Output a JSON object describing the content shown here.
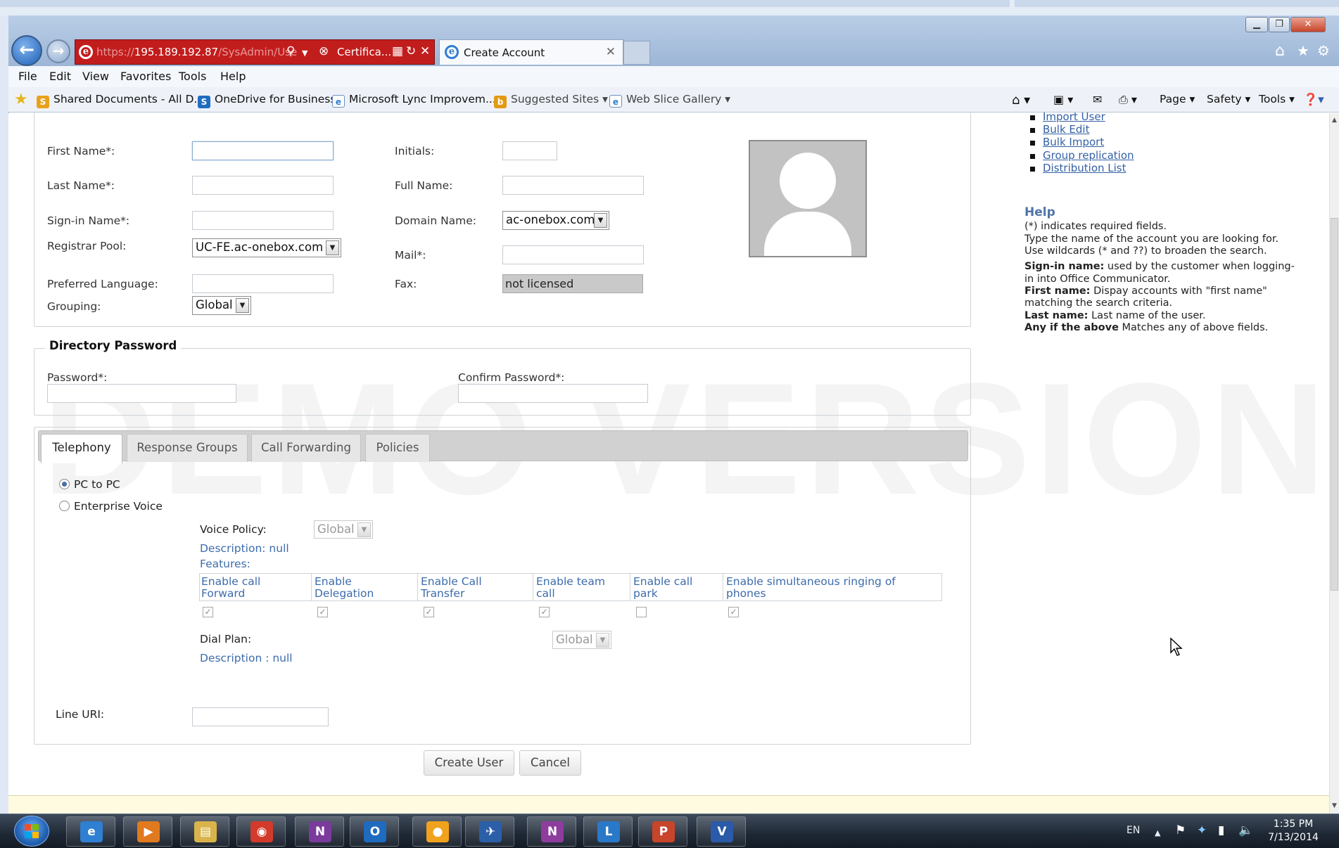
{
  "browser": {
    "url_scheme": "https://",
    "url_host": "195.189.192.87",
    "url_path": "/SysAdmin/Use",
    "certificate_label": "Certifica...",
    "tab_title": "Create Account",
    "window_controls": [
      "minimize-icon",
      "restore-icon",
      "close-icon"
    ],
    "menu": [
      "File",
      "Edit",
      "View",
      "Favorites",
      "Tools",
      "Help"
    ],
    "favorites": [
      {
        "label": "Shared Documents - All D...",
        "icon": "sharepoint-icon"
      },
      {
        "label": "OneDrive for Business",
        "icon": "onedrive-icon"
      },
      {
        "label": "Microsoft Lync Improvem...",
        "icon": "ie-page-icon"
      },
      {
        "label": "Suggested Sites ▾",
        "icon": "bing-icon"
      },
      {
        "label": "Web Slice Gallery ▾",
        "icon": "ie-page-icon"
      }
    ],
    "commands": [
      "Page ▾",
      "Safety ▾",
      "Tools ▾"
    ]
  },
  "account": {
    "labels": {
      "first_name": "First Name*:",
      "last_name": "Last Name*:",
      "signin_name": "Sign-in Name*:",
      "registrar_pool": "Registrar Pool:",
      "preferred_language": "Preferred Language:",
      "grouping": "Grouping:",
      "initials": "Initials:",
      "full_name": "Full Name:",
      "domain_name": "Domain Name:",
      "mail": "Mail*:",
      "fax": "Fax:"
    },
    "registrar_pool_value": "UC-FE.ac-onebox.com",
    "grouping_value": "Global",
    "domain_name_value": "ac-onebox.com",
    "fax_value": "not licensed"
  },
  "directory_password": {
    "title": "Directory Password",
    "password_label": "Password*:",
    "confirm_label": "Confirm Password*:"
  },
  "tabs": [
    "Telephony",
    "Response Groups",
    "Call Forwarding",
    "Policies"
  ],
  "telephony": {
    "options": [
      "PC to PC",
      "Enterprise Voice"
    ],
    "selected": "PC to PC",
    "voice_policy_label": "Voice Policy:",
    "voice_policy_value": "Global",
    "voice_description": "Description: null",
    "features_label": "Features:",
    "features": [
      {
        "line1": "Enable call",
        "line2": "Forward",
        "checked": true
      },
      {
        "line1": "Enable",
        "line2": "Delegation",
        "checked": true
      },
      {
        "line1": "Enable Call",
        "line2": "Transfer",
        "checked": true
      },
      {
        "line1": "Enable team",
        "line2": "call",
        "checked": true
      },
      {
        "line1": "Enable call",
        "line2": "park",
        "checked": false
      },
      {
        "line1": "Enable simultaneous ringing of",
        "line2": "phones",
        "checked": true
      }
    ],
    "dial_plan_label": "Dial Plan:",
    "dial_plan_value": "Global",
    "dial_description": "Description : null",
    "line_uri_label": "Line URI:"
  },
  "buttons": {
    "create": "Create User",
    "cancel": "Cancel"
  },
  "quick_links": [
    "Import User",
    "Bulk Edit",
    "Bulk Import",
    "Group replication",
    "Distribution List"
  ],
  "help": {
    "title": "Help",
    "lines": [
      "(*) indicates required fields.",
      "Type the name of the account you are looking for.",
      "Use wildcards (* and ??) to broaden the search."
    ],
    "signin_term": "Sign-in name:",
    "signin_text_1": " used by the customer when logging-",
    "signin_text_2": "in into Office Communicator.",
    "first_term": "First name:",
    "first_text_1": " Dispay accounts with \"first name\"",
    "first_text_2": "matching the search criteria.",
    "last_term": "Last name:",
    "last_text": " Last name of the user.",
    "any_term": "Any if the above",
    "any_text": " Matches any of above fields."
  },
  "watermark": "DEMO VERSION",
  "taskbar": {
    "apps": [
      {
        "icon": "internet-explorer-icon",
        "glyph": "e",
        "color": "#2f7fd3"
      },
      {
        "icon": "media-player-icon",
        "glyph": "▶",
        "color": "#e07a1f"
      },
      {
        "icon": "file-explorer-icon",
        "glyph": "▤",
        "color": "#d9b44a"
      },
      {
        "icon": "chrome-icon",
        "glyph": "◉",
        "color": "#d23b2b"
      },
      {
        "icon": "onenote-icon",
        "glyph": "N",
        "color": "#7a3b9c"
      },
      {
        "icon": "outlook-icon",
        "glyph": "O",
        "color": "#1f6bbf"
      },
      {
        "icon": "search-pin-icon",
        "glyph": "●",
        "color": "#f0a21d"
      },
      {
        "icon": "network-app-icon",
        "glyph": "✈",
        "color": "#2b5fa8"
      },
      {
        "icon": "onenote-tool-icon",
        "glyph": "N",
        "color": "#8e3c9e"
      },
      {
        "icon": "lync-icon",
        "glyph": "L",
        "color": "#2a78c8"
      },
      {
        "icon": "powerpoint-icon",
        "glyph": "P",
        "color": "#c8442a"
      },
      {
        "icon": "visio-icon",
        "glyph": "V",
        "color": "#2a5aa8"
      }
    ],
    "lang": "EN",
    "time": "1:35 PM",
    "date": "7/13/2014"
  }
}
